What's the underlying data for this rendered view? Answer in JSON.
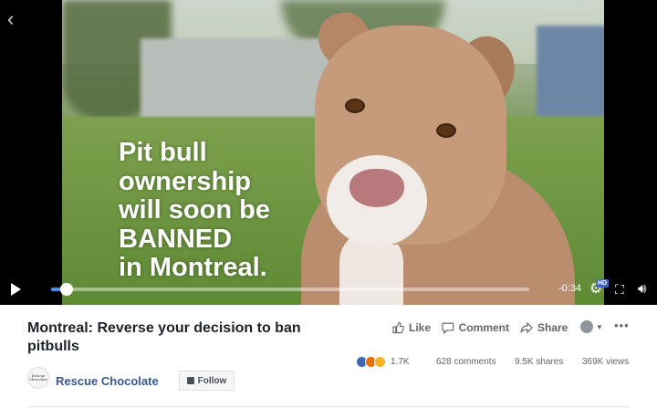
{
  "video": {
    "headline": "Pit bull\nownership\nwill soon be\nBANNED\nin Montreal.",
    "time_remaining": "-0:34",
    "hd_badge": "HD",
    "progress_fraction": 0.04
  },
  "post": {
    "title": "Montreal: Reverse your decision to ban pitbulls",
    "actions": {
      "like": "Like",
      "comment": "Comment",
      "share": "Share"
    },
    "more": "•••",
    "stats": {
      "reactions_count": "1.7K",
      "comments": "628 comments",
      "shares": "9.5K shares",
      "views": "369K views"
    },
    "page": {
      "name": "Rescue Chocolate",
      "avatar_text": "Rescue Chocolate",
      "follow_label": "Follow"
    }
  },
  "colors": {
    "accent": "#4a90e2",
    "link": "#385898",
    "hd": "#4267b2"
  },
  "icons": [
    "back-arrow-icon",
    "play-icon",
    "gear-icon",
    "fullscreen-icon",
    "volume-icon",
    "like-icon",
    "comment-icon",
    "share-icon",
    "globe-icon",
    "follow-icon"
  ]
}
